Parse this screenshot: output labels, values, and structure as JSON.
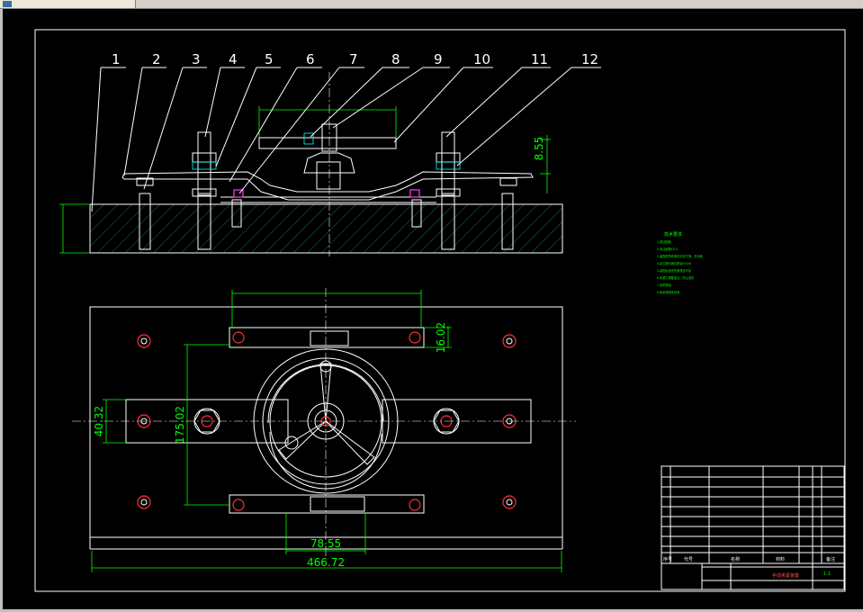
{
  "app": {
    "tab_label": ""
  },
  "drawing": {
    "part_numbers": [
      "1",
      "2",
      "3",
      "4",
      "5",
      "6",
      "7",
      "8",
      "9",
      "10",
      "11",
      "12"
    ],
    "dimensions": {
      "height_right": "8.55",
      "plan_pad_height": "16.02",
      "plan_height": "175.02",
      "plan_bar_height": "40.32",
      "plan_center_width": "78.55",
      "plan_total_width": "466.72"
    },
    "notes": {
      "title": "技术要求",
      "lines": [
        "1.锐边倒钝",
        "2.未注倒角C0.5",
        "3.装配前所有零件清洗干净，去毛刺",
        "4.定位销与销孔配合H7/n6",
        "5.装配后检查夹紧是否可靠",
        "6.夹紧力调整适当，防止变形",
        "7.涂防锈油",
        "8.其余按相关标准"
      ]
    },
    "title_block": {
      "header": [
        "序号",
        "代号",
        "名称",
        "材料",
        "备注"
      ],
      "title": "手动夹紧装置",
      "scale": "1:1"
    }
  },
  "colors": {
    "background": "#000000",
    "lines": "#ffffff",
    "dimensions": "#00ff00",
    "fasteners": "#00ffff",
    "holes": "#ff3030",
    "springs": "#ff40ff"
  }
}
